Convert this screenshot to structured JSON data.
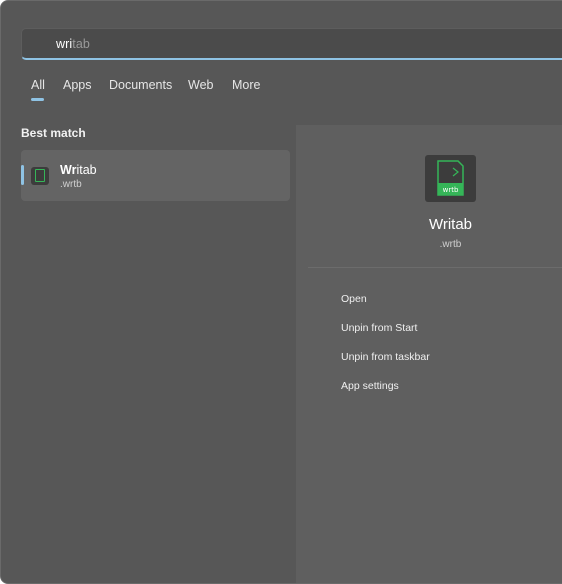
{
  "search": {
    "typed": "wri",
    "suggestion": "tab"
  },
  "tabs": [
    {
      "label": "All",
      "selected": true
    },
    {
      "label": "Apps"
    },
    {
      "label": "Documents"
    },
    {
      "label": "Web"
    },
    {
      "label": "More"
    }
  ],
  "best_match": {
    "title": "Best match",
    "item": {
      "name_bold": "Wr",
      "name_rest": "itab",
      "subtitle": ".wrtb"
    }
  },
  "detail": {
    "icon_label": "wrtb",
    "name": "Writab",
    "subtitle": ".wrtb",
    "actions": [
      "Open",
      "Unpin from Start",
      "Unpin from taskbar",
      "App settings"
    ]
  },
  "colors": {
    "accent": "#8fc3e4",
    "icon_green": "#35b558"
  }
}
